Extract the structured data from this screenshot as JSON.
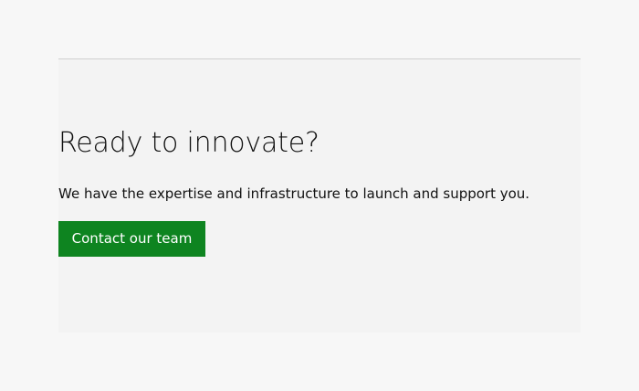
{
  "cta": {
    "heading": "Ready to innovate?",
    "text": "We have the expertise and infrastructure to launch and support you.",
    "button_label": "Contact our team"
  },
  "colors": {
    "page_background": "#f7f7f7",
    "section_background": "#f3f3f3",
    "button_background": "#0e8420",
    "button_text": "#ffffff",
    "text": "#111111",
    "divider": "#cfcfcf"
  }
}
